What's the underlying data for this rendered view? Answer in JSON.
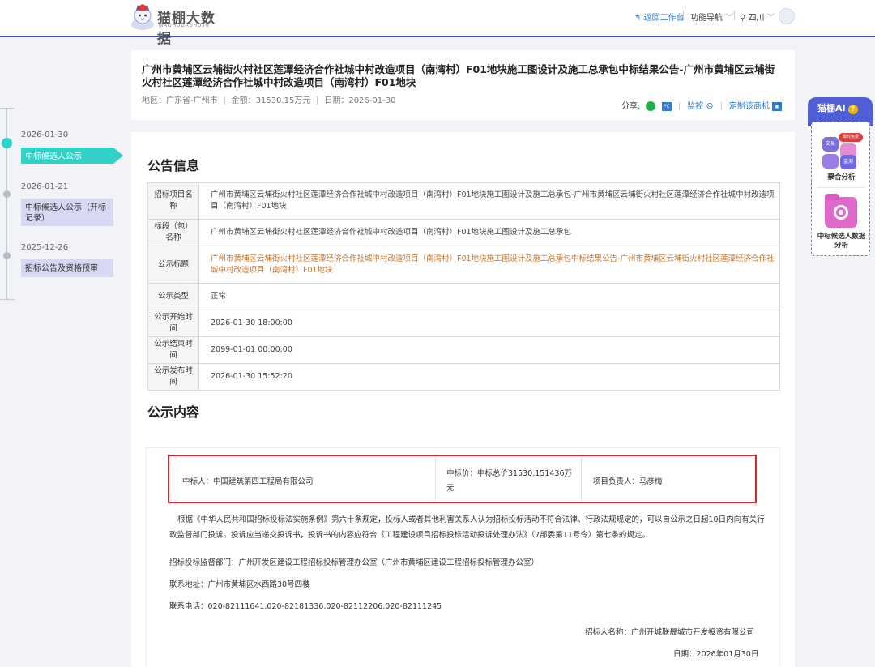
{
  "header": {
    "logo_title": "猫棚大数据",
    "logo_sub": "MAOHUDASHUJU",
    "back_label": "返回工作台",
    "nav_label": "功能导航",
    "region_label": "四川"
  },
  "timeline": [
    {
      "date": "2026-01-30",
      "label": "中标候选人公示",
      "active": true
    },
    {
      "date": "2026-01-21",
      "label": "中标候选人公示（开标记录）",
      "active": false
    },
    {
      "date": "2025-12-26",
      "label": "招标公告及资格预审",
      "active": false
    }
  ],
  "title_card": {
    "title": "广州市黄埔区云埔街火村社区莲潭经济合作社城中村改造项目（南湾村）F01地块施工图设计及施工总承包中标结果公告-广州市黄埔区云埔街火村社区莲潭经济合作社城中村改造项目（南湾村）F01地块",
    "region": "地区：广东省-广州市",
    "amount": "金额：31530.15万元",
    "date": "日期：2026-01-30",
    "share_label": "分享:",
    "pc_label": "PC",
    "monitor_label": "监控",
    "subscribe_label": "定制该商机"
  },
  "info": {
    "section_title": "公告信息",
    "rows": [
      {
        "label": "招标项目名称",
        "value": "广州市黄埔区云埔街火村社区莲潭经济合作社城中村改造项目（南湾村）F01地块施工图设计及施工总承包-广州市黄埔区云埔街火村社区莲潭经济合作社城中村改造项目（南湾村）F01地块"
      },
      {
        "label": "标段（包）名称",
        "value": "广州市黄埔区云埔街火村社区莲潭经济合作社城中村改造项目（南湾村）F01地块施工图设计及施工总承包"
      },
      {
        "label": "公示标题",
        "value": "广州市黄埔区云埔街火村社区莲潭经济合作社城中村改造项目（南湾村）F01地块施工图设计及施工总承包中标结果公告-广州市黄埔区云埔街火村社区莲潭经济合作社城中村改造项目（南湾村）F01地块"
      },
      {
        "label": "公示类型",
        "value": "正常"
      },
      {
        "label": "公示开始时间",
        "value": "2026-01-30 18:00:00"
      },
      {
        "label": "公示结束时间",
        "value": "2099-01-01 00:00:00"
      },
      {
        "label": "公示发布时间",
        "value": "2026-01-30 15:52:20"
      }
    ]
  },
  "content": {
    "section_title": "公示内容",
    "winner": "中标人：中国建筑第四工程局有限公司",
    "price": "中标价：中标总价31530.151436万元",
    "manager": "项目负责人：马彦梅",
    "para1": "根据《中华人民共和国招标投标法实施条例》第六十条规定，投标人或者其他利害关系人认为招标投标活动不符合法律、行政法规规定的，可以自公示之日起10日内向有关行政监督部门投诉。投诉应当递交投诉书，投诉书的内容应符合《工程建设项目招标投标活动投诉处理办法》（7部委第11号令）第七条的规定。",
    "supervisor": "招标投标监督部门：广州开发区建设工程招标投标管理办公室（广州市黄埔区建设工程招标投标管理办公室）",
    "address": "联系地址：广州市黄埔区水西路30号四楼",
    "phone": "联系电话：020-82111641,020-82181336,020-82112206,020-82111245",
    "tenderer": "招标人名称：广州开城联晟城市开发投资有限公司",
    "date": "日期：2026年01月30日"
  },
  "ai_panel": {
    "tab_label": "猫棚AI",
    "q_label": "?",
    "badge": "限时免费",
    "tile_trade": "交易",
    "tile_monitor": "监测",
    "agg_label": "聚合分析",
    "data_label": "中标候选人数据分析"
  },
  "colors": {
    "brand": "#3f4aa5",
    "accent_teal": "#32d1c7",
    "link_blue": "#2e7bd6",
    "highlight_red": "#d42a2a",
    "orange_text": "#c8732a"
  }
}
